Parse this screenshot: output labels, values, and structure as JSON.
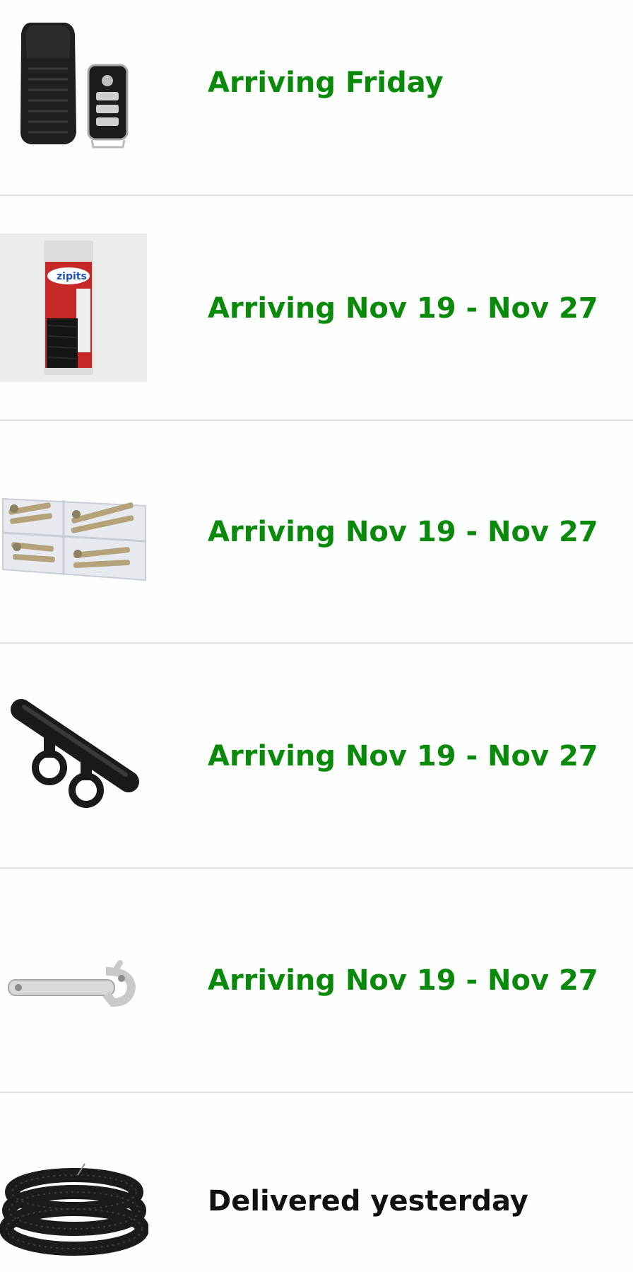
{
  "orders": [
    {
      "product_icon": "bike-alarm-with-remote-icon",
      "status": "Arriving Friday",
      "state": "arriving"
    },
    {
      "product_icon": "zip-ties-package-icon",
      "status": "Arriving Nov 19 - Nov 27",
      "state": "arriving"
    },
    {
      "product_icon": "screw-assortment-box-icon",
      "status": "Arriving Nov 19 - Nov 27",
      "state": "arriving"
    },
    {
      "product_icon": "handlebar-extender-icon",
      "status": "Arriving Nov 19 - Nov 27",
      "state": "arriving"
    },
    {
      "product_icon": "hook-spanner-wrench-icon",
      "status": "Arriving Nov 19 - Nov 27",
      "state": "arriving"
    },
    {
      "product_icon": "corrugated-tubing-icon",
      "status": "Delivered yesterday",
      "state": "delivered"
    }
  ],
  "colors": {
    "arriving": "#0a8a0a",
    "delivered": "#111111",
    "divider": "#e3e3e3"
  }
}
